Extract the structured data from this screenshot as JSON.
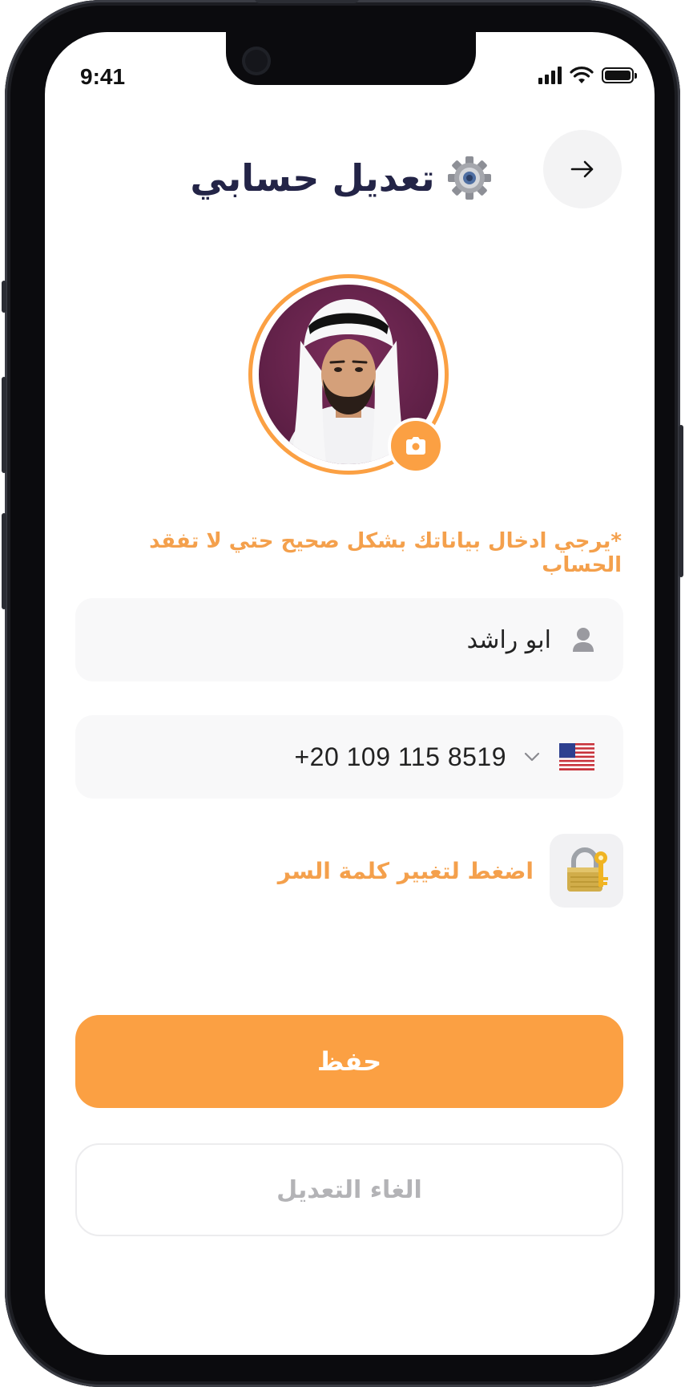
{
  "status_bar": {
    "time": "9:41"
  },
  "header": {
    "title": "تعديل حسابي"
  },
  "notice": "*يرجي ادخال بياناتك بشكل صحيح حتي لا تفقد الحساب",
  "form": {
    "name_value": "ابو راشد",
    "phone_value": "+20 109 115 8519",
    "country_flag": "us-flag-icon"
  },
  "password_link": "اضغط لتغيير كلمة السر",
  "buttons": {
    "save": "حفظ",
    "cancel": "الغاء التعديل"
  },
  "colors": {
    "accent": "#fba043",
    "title": "#232447",
    "field_bg": "#f8f8f9"
  }
}
